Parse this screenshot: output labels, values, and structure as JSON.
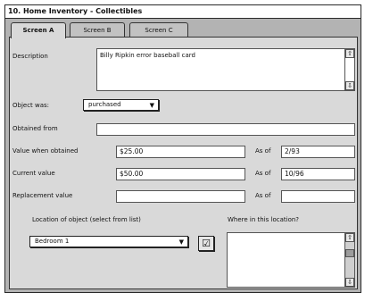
{
  "window": {
    "title": "10. Home Inventory - Collectibles"
  },
  "tabs": [
    {
      "label": "Screen A",
      "active": true
    },
    {
      "label": "Screen B",
      "active": false
    },
    {
      "label": "Screen C",
      "active": false
    }
  ],
  "form": {
    "description_label": "Description",
    "description_value": "Billy Ripkin error baseball card",
    "object_was_label": "Object was:",
    "object_was_value": "purchased",
    "obtained_from_label": "Obtained from",
    "obtained_from_value": "",
    "value_when_obtained_label": "Value when obtained",
    "value_when_obtained_value": "$25.00",
    "value_when_obtained_asof_label": "As of",
    "value_when_obtained_asof_value": "2/93",
    "current_value_label": "Current value",
    "current_value_value": "$50.00",
    "current_value_asof_label": "As of",
    "current_value_asof_value": "10/96",
    "replacement_value_label": "Replacement value",
    "replacement_value_value": "",
    "replacement_value_asof_label": "As of",
    "replacement_value_asof_value": "",
    "location_label": "Location of object (select from list)",
    "location_value": "Bedroom 1",
    "where_label": "Where in this location?",
    "where_value": ""
  },
  "icons": {
    "dropdown_caret": "▼",
    "scroll_up": "⇧",
    "scroll_down": "⇩",
    "check": "☑"
  }
}
